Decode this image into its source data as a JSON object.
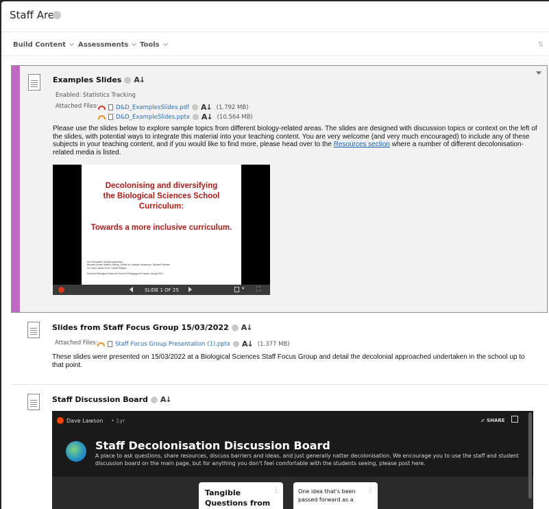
{
  "page": {
    "title": "Staff Area"
  },
  "action_bar": {
    "build_content": "Build Content",
    "assessments": "Assessments",
    "tools": "Tools"
  },
  "items": [
    {
      "title": "Examples Slides",
      "enabled_label": "Enabled:",
      "enabled_value": "Statistics Tracking",
      "attached_label": "Attached Files:",
      "files": [
        {
          "name": "D&D_ExamplesSlides.pdf",
          "size": "(1.792 MB)"
        },
        {
          "name": "D&D_ExampleSlides.pptx",
          "size": "(10.564 MB)"
        }
      ],
      "description_before_link": "Please use the slides below to explore sample topics from different biology-related areas. The slides are designed with discussion topics or context on the left of the slides, with potential ways to integrate this material into your teaching content. You are very welcome (and very much encouraged) to include any of these subjects in your teaching content, and if you would like to find more, please head over to the ",
      "description_link": "Resources section",
      "description_after_link": " where a number of different decolonisation-related media is listed.",
      "slide": {
        "heading_line1": "Decolonising and diversifying",
        "heading_line2": "the Biological Sciences School",
        "heading_line3": "Curriculum:",
        "subheading": "Towards a more inclusive curriculum.",
        "credit_1": "Iml Chehrabeti, Student supervisor",
        "credit_2": "Kemara Vemal, Mikhilur Rahay, Cecile Orr, Adaeze Henderson, Student Partners",
        "credit_3": "Dr. Dave Lawson & Dr. Celine Pettpen",
        "credit_4": "School of Biological Sciences Fund for Pedagogical Projects, Spring 2021",
        "counter": "SLIDE 1 OF 25"
      }
    },
    {
      "title": "Slides from Staff Focus Group 15/03/2022",
      "attached_label": "Attached Files:",
      "files": [
        {
          "name": "Staff Focus Group Presentation (1).pptx",
          "size": "(1.377 MB)"
        }
      ],
      "description": "These slides were presented on 15/03/2022 at a Biological Sciences Staff Focus Group and detail the decolonial approached undertaken in the school up to that point."
    },
    {
      "title": "Staff Discussion Board",
      "embed": {
        "author": "Dave Lawson",
        "time": "1yr",
        "share": "SHARE",
        "board_title": "Staff Decolonisation Discussion Board",
        "board_description": "A place to ask questions, share resources, discuss barriers and ideas, and just generally natter decolonisation. We encourage you to use the staff and student discussion board on the main page, but for anything you don't feel comfortable with the students seeing, please post here.",
        "card1_line1": "Tangible",
        "card1_line2": "Questions from",
        "card2_line1": "One idea that's been",
        "card2_line2": "passed forward as a",
        "card2_line3": "..."
      }
    }
  ],
  "icons": {
    "az_icon": "A↓",
    "drag": "⋮"
  },
  "colors": {
    "accent_purple": "#c169c7",
    "link_blue": "#2a6ebb",
    "gauge_red": "#d9362a",
    "gauge_orange": "#e8921e",
    "slide_red": "#b01b16",
    "reddit_orange": "#ff4500"
  }
}
